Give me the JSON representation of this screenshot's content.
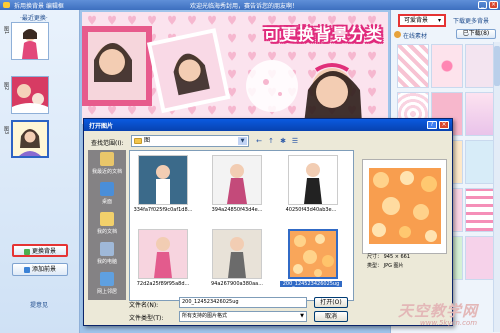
{
  "window": {
    "title": "拆用换背景 编辑框",
    "message": "欢迎光临海秀封用，赛告诉您的朋友啊！",
    "min_label": "_",
    "close_label": "×"
  },
  "left_panel": {
    "header": "·最近更换·",
    "thumbs": [
      {
        "tab": "图1"
      },
      {
        "tab": "图2"
      },
      {
        "tab": "图3"
      }
    ],
    "change_bg_button": "更换背景",
    "add_bg_button": "添加前景",
    "feedback": "提意见"
  },
  "headline": "可更换背景分类",
  "right_panel": {
    "bg_select": "可爱背景",
    "download_more": "下载更多背景",
    "local_label": "在线素材",
    "downloaded_button": "已下载(8)"
  },
  "dialog": {
    "title": "打开图片",
    "help": "?",
    "close": "×",
    "look_in_label": "查找范围(I):",
    "look_in_value": "图",
    "places": [
      {
        "label": "我最近的文档"
      },
      {
        "label": "桌面"
      },
      {
        "label": "我的文档"
      },
      {
        "label": "我的电脑"
      },
      {
        "label": "网上邻居"
      }
    ],
    "files": [
      {
        "name": "334fa7f025f9c0af1d8..."
      },
      {
        "name": "394a24850f43d4e..."
      },
      {
        "name": "40250f43d40ab3e..."
      },
      {
        "name": "72d2a25f89f95a8d..."
      },
      {
        "name": "94a267900a380aa..."
      },
      {
        "name": "200_124523426025ug"
      }
    ],
    "size_text": "尺寸： 945 × 661",
    "type_text": "类型： JPG 图片",
    "file_name_label": "文件名(N):",
    "file_name_value": "200_124523426025ug",
    "file_type_label": "文件类型(T):",
    "file_type_value": "所有支持的图片格式",
    "open_button": "打开(O)",
    "cancel_button": "取消"
  },
  "watermark": {
    "text": "天空教学网",
    "url": "www.5kycn.com"
  },
  "colors": {
    "accent_red": "#e53333",
    "headline_pink": "#e02a7c",
    "xp_blue": "#0a5ae0"
  }
}
